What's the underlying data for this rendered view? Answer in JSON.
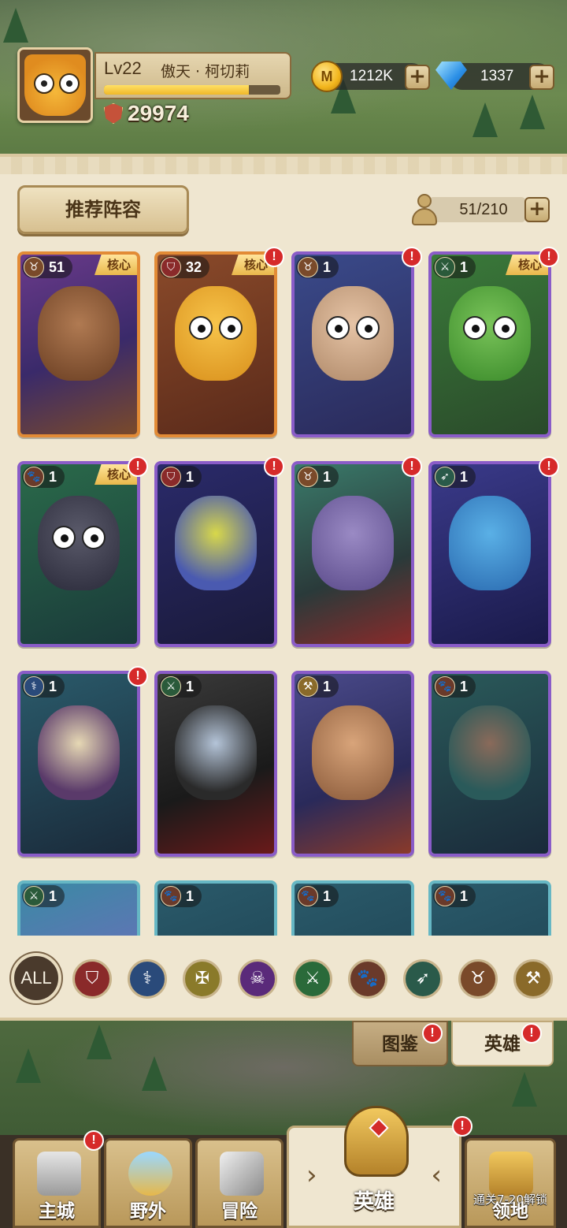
{
  "player": {
    "level": "Lv22",
    "name": "傲天 · 柯切莉",
    "xp_fraction": 0.82,
    "power": "29974"
  },
  "resources": {
    "gold": "1212K",
    "gold_symbol": "M",
    "gems": "1337"
  },
  "panel": {
    "recommend_label": "推荐阵容",
    "capacity": "51/210"
  },
  "colors": {
    "card_purple": "#8a5cc8",
    "card_orange": "#e28b36",
    "card_teal": "#66b7c4",
    "alert": "#d62a2a"
  },
  "heroes": [
    {
      "level": "1",
      "cls": "bull-icon",
      "core": "核心"
    },
    {
      "level": "51",
      "cls": "bull-icon",
      "core": "核心"
    },
    {
      "level": "32",
      "cls": "shield-icon",
      "core": "核心"
    },
    {
      "level": "1",
      "cls": "bull-icon"
    },
    {
      "level": "1",
      "cls": "swords-icon",
      "core": "核心"
    },
    {
      "level": "1",
      "cls": "paw-icon",
      "core": "核心"
    },
    {
      "level": "1",
      "cls": "shield-icon"
    },
    {
      "level": "1",
      "cls": "bull-icon"
    },
    {
      "level": "1",
      "cls": "bow-icon"
    },
    {
      "level": "1",
      "cls": "staff-icon"
    },
    {
      "level": "1",
      "cls": "swords-icon"
    },
    {
      "level": "1",
      "cls": "hammer-icon"
    },
    {
      "level": "1",
      "cls": "paw-icon"
    },
    {
      "level": "1",
      "cls": "swords-icon"
    },
    {
      "level": "1",
      "cls": "paw-icon"
    },
    {
      "level": "1",
      "cls": "paw-icon"
    },
    {
      "level": "1",
      "cls": "paw-icon"
    }
  ],
  "alert_mark": "!",
  "filter": {
    "all_label": "ALL",
    "classes": [
      "shield-icon",
      "staff-icon",
      "holy-icon",
      "skull-icon",
      "swords-icon",
      "paw-icon",
      "bow-icon",
      "bull-icon",
      "hammer-icon"
    ]
  },
  "tabs": {
    "archive": "图鉴",
    "heroes": "英雄"
  },
  "nav": {
    "city": "主城",
    "wild": "野外",
    "adventure": "冒险",
    "heroes": "英雄",
    "territory": "领地",
    "territory_lock": "通关7-20解锁"
  }
}
